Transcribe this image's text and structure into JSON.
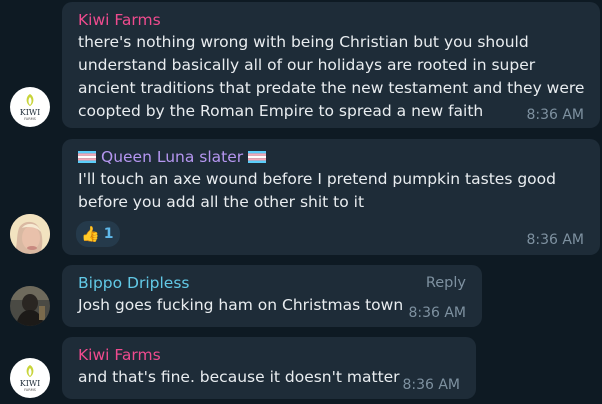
{
  "messages": [
    {
      "sender": "Kiwi Farms",
      "sender_color": "#ee4b8e",
      "text": "there's nothing wrong with being Christian but you should\nunderstand basically all of our holidays are rooted in super\nancient traditions that predate the new testament and they were\ncoopted by the Roman Empire to spread a new faith",
      "time": "8:36 AM",
      "avatar": {
        "label": "KIWI",
        "sub": "FARMS",
        "icon": "kiwi-sprout-icon"
      }
    },
    {
      "sender": "Queen Luna slater",
      "sender_color": "#b596f0",
      "sender_prefix_icon": "trans-flag-icon",
      "sender_suffix_icon": "trans-flag-icon",
      "text": "I'll touch an axe wound before I pretend pumpkin tastes good\nbefore you add all the other shit to it",
      "time": "8:36 AM",
      "reaction": {
        "emoji": "👍",
        "count": "1"
      },
      "avatar": {
        "icon": "blonde-user-photo"
      }
    },
    {
      "sender": "Bippo Dripless",
      "sender_color": "#62c9e6",
      "text": "Josh goes fucking ham on Christmas town",
      "time": "8:36 AM",
      "reply_label": "Reply",
      "avatar": {
        "icon": "dark-user-photo"
      }
    },
    {
      "sender": "Kiwi Farms",
      "sender_color": "#ee4b8e",
      "text": "and that's fine. because it doesn't matter",
      "time": "8:36 AM",
      "avatar": {
        "label": "KIWI",
        "sub": "FARMS",
        "icon": "kiwi-sprout-icon"
      }
    }
  ],
  "colors": {
    "background": "#0e1a23",
    "bubble": "#1e2c38",
    "text": "#e9edf0",
    "meta": "#7e91a0",
    "reaction_bg": "#253a4b",
    "reaction_count": "#5fb8ea"
  }
}
